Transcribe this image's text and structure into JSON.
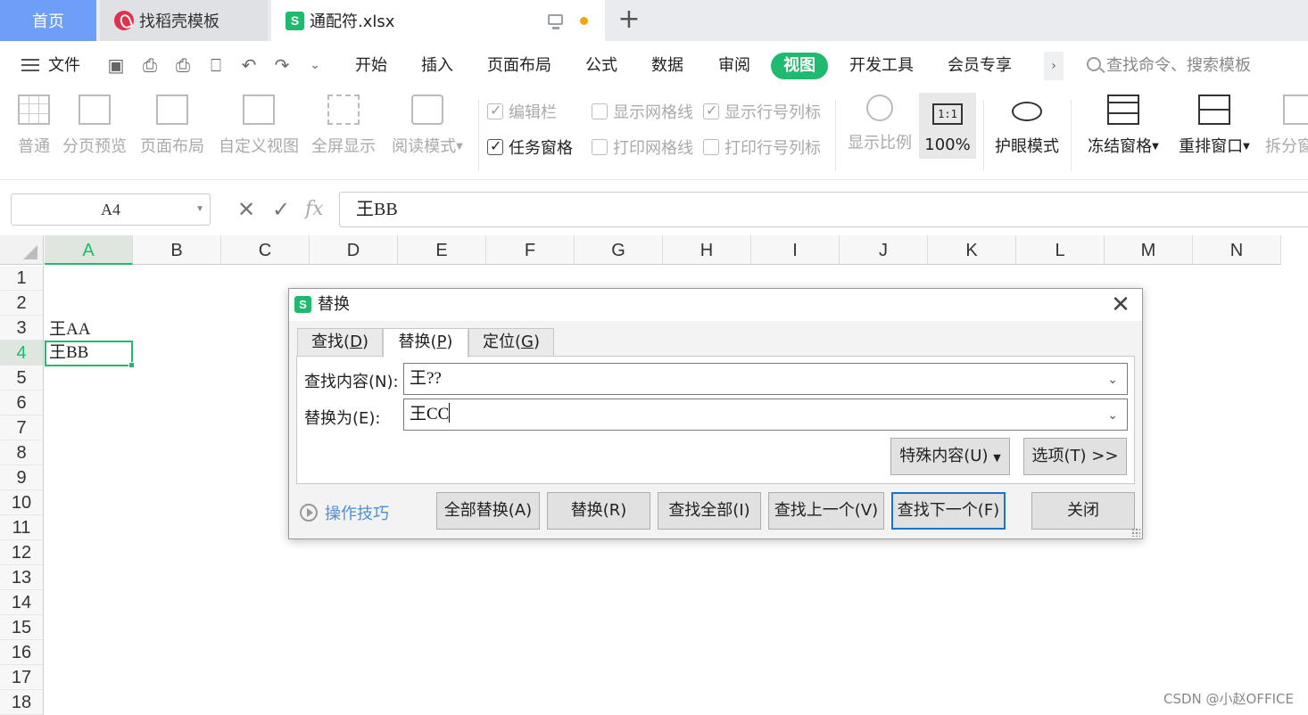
{
  "tabs": {
    "home": "首页",
    "doc": "找稻壳模板",
    "file": "通配符.xlsx",
    "file_icon": "S"
  },
  "menu": {
    "file": "文件",
    "items": [
      "开始",
      "插入",
      "页面布局",
      "公式",
      "数据",
      "审阅",
      "视图",
      "开发工具",
      "会员专享"
    ],
    "active": "视图",
    "search_placeholder": "查找命令、搜索模板"
  },
  "ribbon": {
    "normal": "普通",
    "page_break": "分页预览",
    "page_layout": "页面布局",
    "custom_view": "自定义视图",
    "full_screen": "全屏显示",
    "reading_mode": "阅读模式",
    "edit_bar": "编辑栏",
    "task_pane": "任务窗格",
    "show_gridlines": "显示网格线",
    "print_gridlines": "打印网格线",
    "show_headers": "显示行号列标",
    "print_headers": "打印行号列标",
    "zoom": "显示比例",
    "zoom_100": "100%",
    "zoom_100_icon": "1:1",
    "eye_mode": "护眼模式",
    "freeze": "冻结窗格",
    "rearrange": "重排窗口",
    "split": "拆分窗"
  },
  "formula_bar": {
    "name_box": "A4",
    "content": "王BB",
    "fx": "fx"
  },
  "sheet": {
    "columns": [
      "A",
      "B",
      "C",
      "D",
      "E",
      "F",
      "G",
      "H",
      "I",
      "J",
      "K",
      "L",
      "M",
      "N"
    ],
    "rows": [
      "1",
      "2",
      "3",
      "4",
      "5",
      "6",
      "7",
      "8",
      "9",
      "10",
      "11",
      "12",
      "13",
      "14",
      "15",
      "16",
      "17",
      "18"
    ],
    "cells": {
      "A3": "王AA",
      "A4": "王BB"
    },
    "selected": "A4"
  },
  "dialog": {
    "title": "替换",
    "tabs": [
      {
        "text": "查找(",
        "key": "D",
        "end": ")"
      },
      {
        "text": "替换(",
        "key": "P",
        "end": ")"
      },
      {
        "text": "定位(",
        "key": "G",
        "end": ")"
      }
    ],
    "find_label": "查找内容(N):",
    "find_value": "王??",
    "replace_label": "替换为(E):",
    "replace_value": "王CC",
    "special_button": "特殊内容(U)",
    "options_button": "选项(T) >>",
    "tips": "操作技巧",
    "buttons": {
      "replace_all": "全部替换(A)",
      "replace": "替换(R)",
      "find_all": "查找全部(I)",
      "find_prev": "查找上一个(V)",
      "find_next": "查找下一个(F)",
      "close": "关闭"
    }
  },
  "watermark": "CSDN @小赵OFFICE",
  "colors": {
    "accent": "#1ebb6e",
    "tab_home": "#6d9ef8",
    "primary_border": "#1a73c9",
    "link": "#4a90d9"
  }
}
